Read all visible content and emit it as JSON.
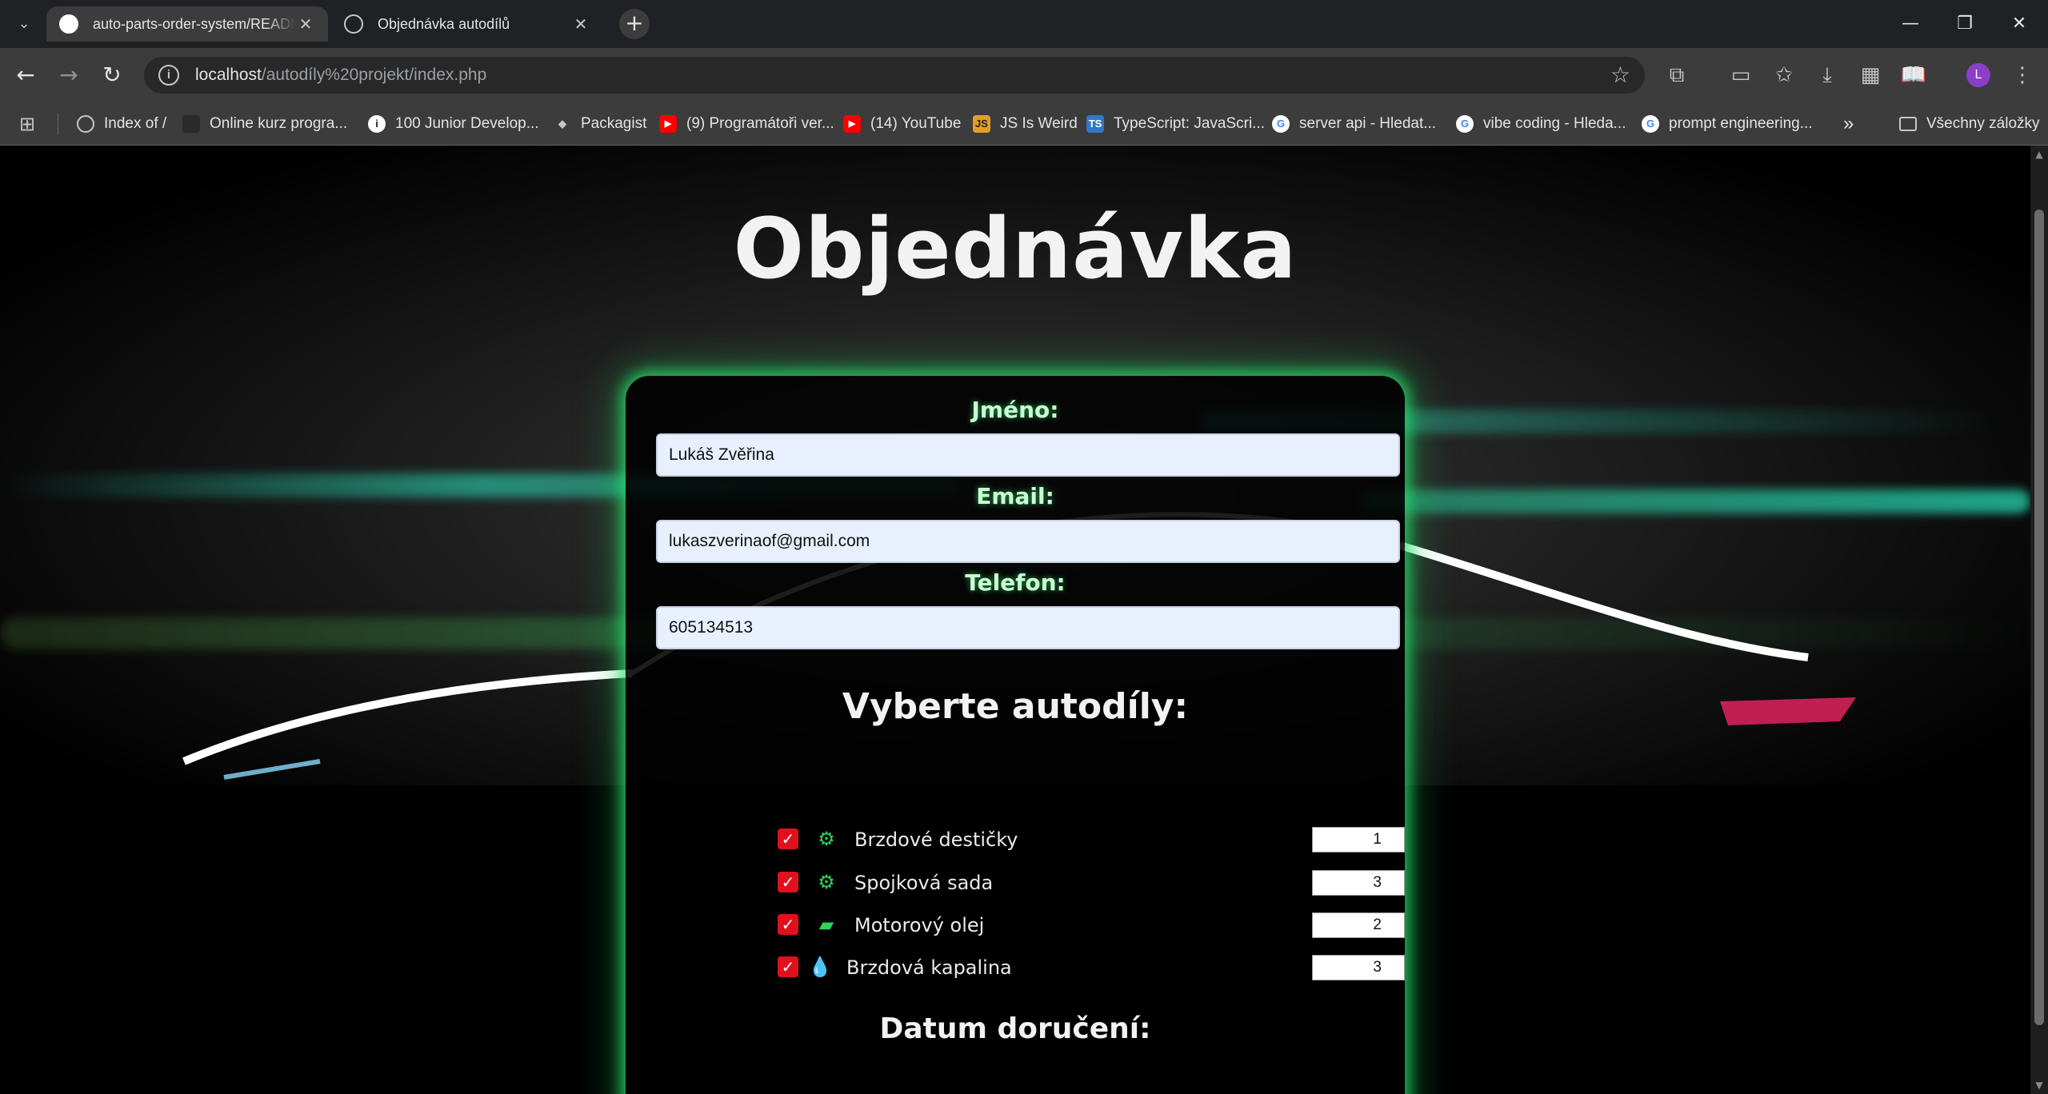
{
  "browser": {
    "tabs": [
      {
        "title": "auto-parts-order-system/READM",
        "active": true
      },
      {
        "title": "Objednávka autodílů",
        "active": false
      }
    ],
    "new_tab": "+",
    "address": {
      "host": "localhost",
      "path": "/autodíly%20projekt/index.php"
    },
    "profile_initial": "L",
    "bookmarks": [
      {
        "label": "Index of /",
        "icon": "globe-icon"
      },
      {
        "label": "Online kurz progra...",
        "icon": "site-icon"
      },
      {
        "label": "100 Junior Develop...",
        "icon": "info-icon"
      },
      {
        "label": "Packagist",
        "icon": "packagist-icon"
      },
      {
        "label": "(9) Programátoři ver...",
        "icon": "youtube-icon"
      },
      {
        "label": "(14) YouTube",
        "icon": "youtube-icon"
      },
      {
        "label": "JS Is Weird",
        "icon": "js-icon"
      },
      {
        "label": "TypeScript: JavaScri...",
        "icon": "ts-icon"
      },
      {
        "label": "server api - Hledat...",
        "icon": "google-icon"
      },
      {
        "label": "vibe coding - Hleda...",
        "icon": "google-icon"
      },
      {
        "label": "prompt engineering...",
        "icon": "google-icon"
      }
    ],
    "more_bookmarks": "»",
    "all_bookmarks": "Všechny záložky",
    "colors": {
      "chrome": "#3c3c3c",
      "tabstrip": "#202124",
      "avatar": "#8b3ec7"
    }
  },
  "page": {
    "title": "Objednávka",
    "form": {
      "name_label": "Jméno:",
      "name_value": "Lukáš Zvěřina",
      "email_label": "Email:",
      "email_value": "lukaszverinaof@gmail.com",
      "phone_label": "Telefon:",
      "phone_value": "605134513"
    },
    "parts_title": "Vyberte autodíly:",
    "parts": [
      {
        "label": "Brzdové destičky",
        "icon": "brake-pad-icon",
        "checked": true,
        "quantity": "1"
      },
      {
        "label": "Spojková sada",
        "icon": "gears-icon",
        "checked": true,
        "quantity": "3"
      },
      {
        "label": "Motorový olej",
        "icon": "oil-can-icon",
        "checked": true,
        "quantity": "2"
      },
      {
        "label": "Brzdová kapalina",
        "icon": "droplet-icon",
        "checked": true,
        "quantity": "3"
      }
    ],
    "delivery_title": "Datum doručení:",
    "colors": {
      "accent_glow": "#28e66e",
      "checkbox": "#e0101e",
      "icon": "#2fd35a",
      "input_bg": "#e8f0fe"
    }
  }
}
